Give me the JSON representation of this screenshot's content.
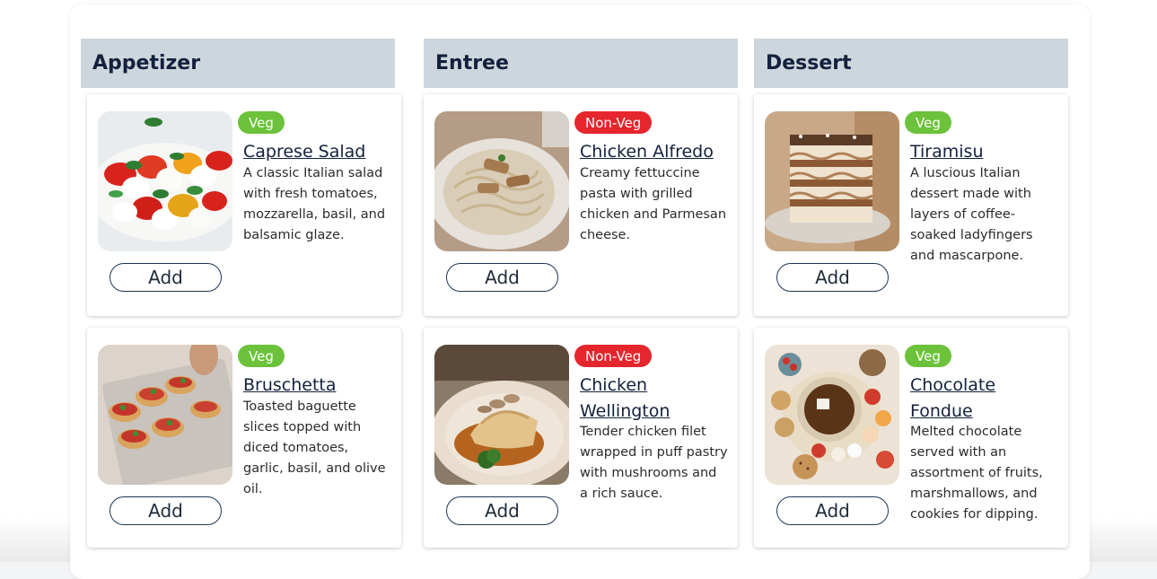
{
  "columns": [
    {
      "title": "Appetizer",
      "items": [
        {
          "tag": "Veg",
          "name": "Caprese Salad",
          "description": "A classic Italian salad with fresh tomatoes, mozzarella, basil, and balsamic glaze.",
          "button": "Add"
        },
        {
          "tag": "Veg",
          "name": "Bruschetta",
          "description": "Toasted baguette slices topped with diced tomatoes, garlic, basil, and olive oil.",
          "button": "Add"
        }
      ]
    },
    {
      "title": "Entree",
      "items": [
        {
          "tag": "Non-Veg",
          "name": "Chicken Alfredo",
          "description": "Creamy fettuccine pasta with grilled chicken and Parmesan cheese.",
          "button": "Add"
        },
        {
          "tag": "Non-Veg",
          "name": "Chicken Wellington",
          "description": "Tender chicken filet wrapped in puff pastry with mushrooms and a rich sauce.",
          "button": "Add"
        }
      ]
    },
    {
      "title": "Dessert",
      "items": [
        {
          "tag": "Veg",
          "name": "Tiramisu",
          "description": "A luscious Italian dessert made with layers of coffee-soaked ladyfingers and mascarpone.",
          "button": "Add"
        },
        {
          "tag": "Veg",
          "name": "Chocolate Fondue",
          "description": "Melted chocolate served with an assortment of fruits, marshmallows, and cookies for dipping.",
          "button": "Add"
        }
      ]
    }
  ],
  "colors": {
    "veg": "#6cc23a",
    "non_veg": "#e5262d",
    "header_bg": "#cdd6dc",
    "text_dark": "#14213d"
  },
  "images": [
    "caprese-salad-photo",
    "bruschetta-photo",
    "chicken-alfredo-photo",
    "chicken-wellington-photo",
    "tiramisu-photo",
    "chocolate-fondue-photo"
  ]
}
